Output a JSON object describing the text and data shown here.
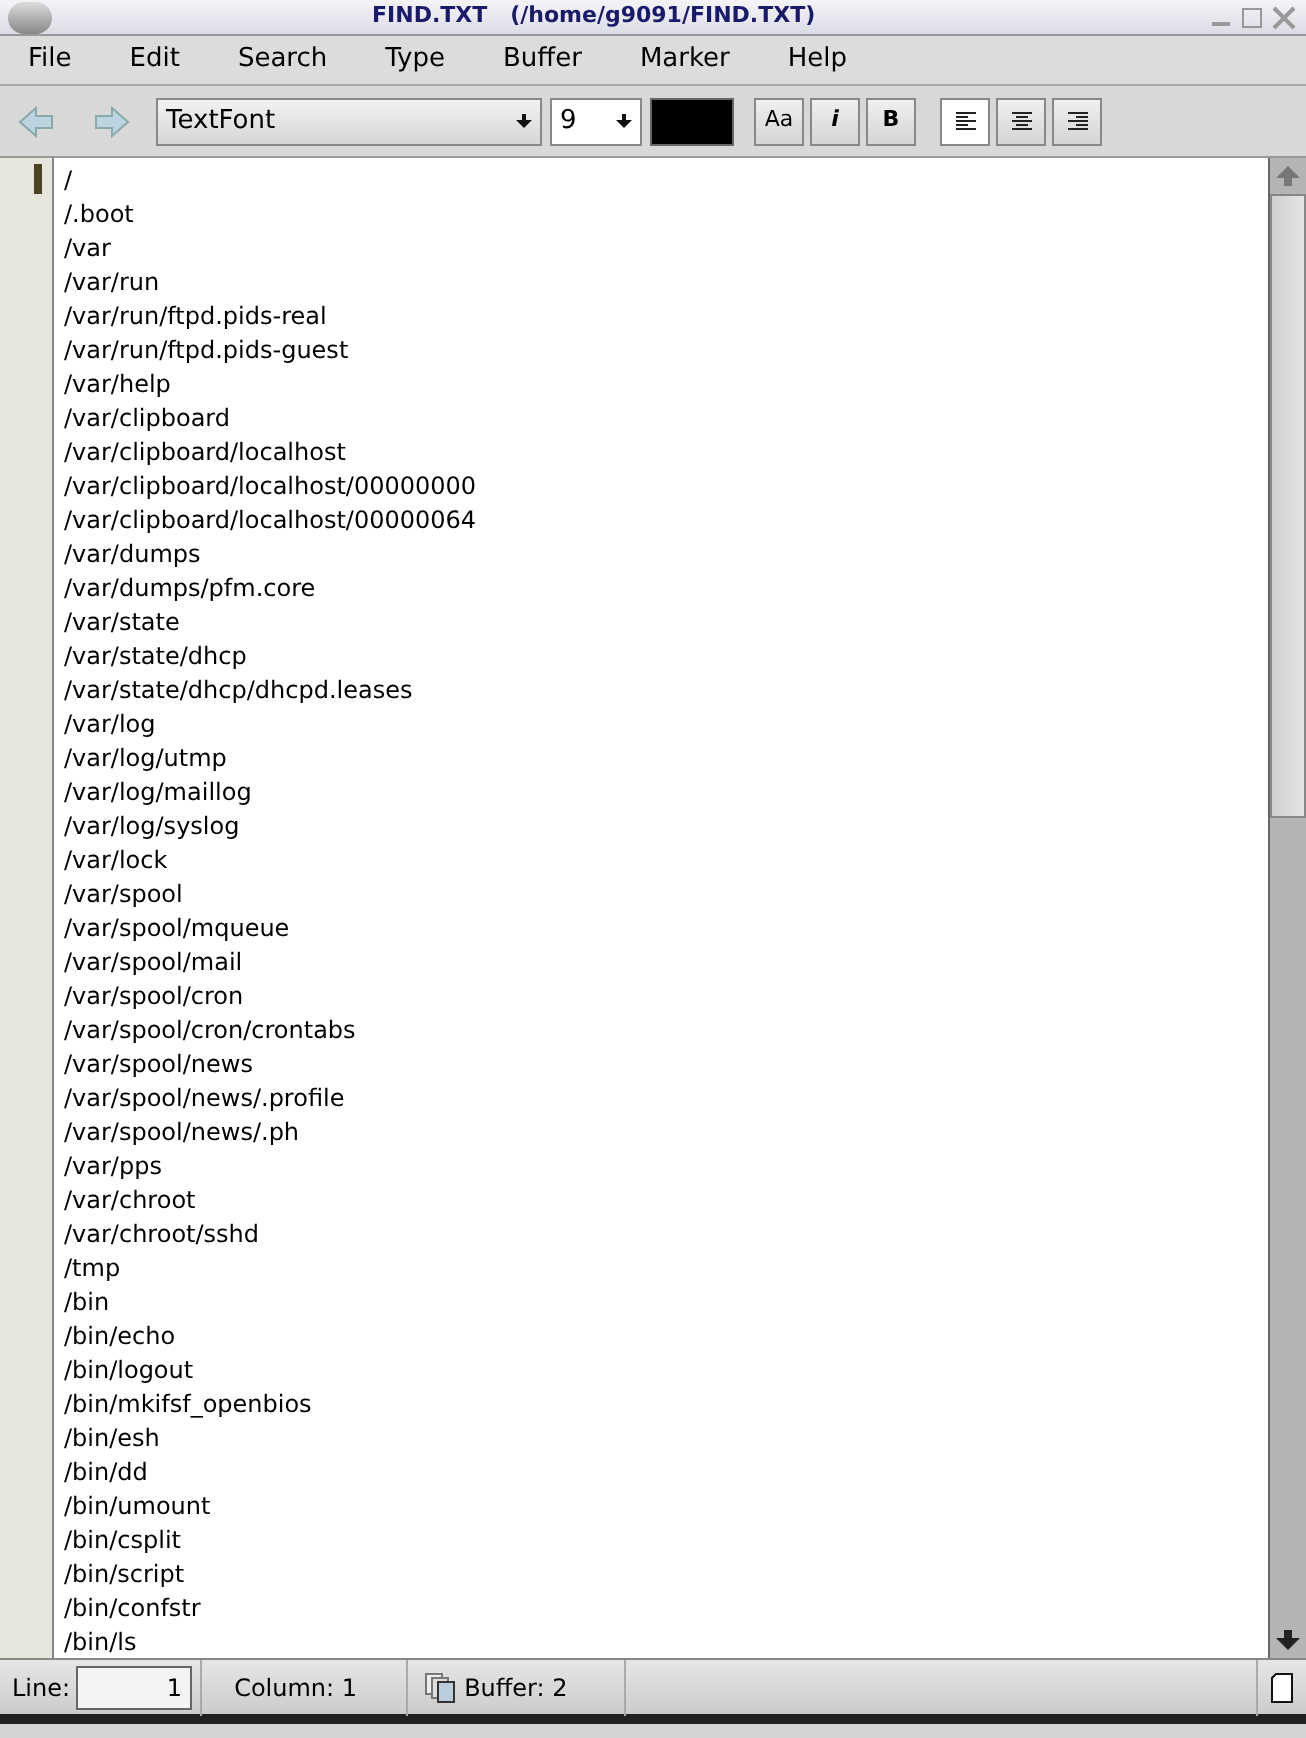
{
  "window": {
    "title": "FIND.TXT   (/home/g9091/FIND.TXT)"
  },
  "menu": [
    "File",
    "Edit",
    "Search",
    "Type",
    "Buffer",
    "Marker",
    "Help"
  ],
  "toolbar": {
    "font": "TextFont",
    "size": "9",
    "styles": [
      {
        "label": "Aa",
        "kind": "plain"
      },
      {
        "label": "i",
        "kind": "italic"
      },
      {
        "label": "B",
        "kind": "bold"
      }
    ],
    "align": [
      {
        "kind": "left",
        "selected": true
      },
      {
        "kind": "center",
        "selected": false
      },
      {
        "kind": "right",
        "selected": false
      }
    ]
  },
  "lines": [
    "/",
    "/.boot",
    "/var",
    "/var/run",
    "/var/run/ftpd.pids-real",
    "/var/run/ftpd.pids-guest",
    "/var/help",
    "/var/clipboard",
    "/var/clipboard/localhost",
    "/var/clipboard/localhost/00000000",
    "/var/clipboard/localhost/00000064",
    "/var/dumps",
    "/var/dumps/pfm.core",
    "/var/state",
    "/var/state/dhcp",
    "/var/state/dhcp/dhcpd.leases",
    "/var/log",
    "/var/log/utmp",
    "/var/log/maillog",
    "/var/log/syslog",
    "/var/lock",
    "/var/spool",
    "/var/spool/mqueue",
    "/var/spool/mail",
    "/var/spool/cron",
    "/var/spool/cron/crontabs",
    "/var/spool/news",
    "/var/spool/news/.profile",
    "/var/spool/news/.ph",
    "/var/pps",
    "/var/chroot",
    "/var/chroot/sshd",
    "/tmp",
    "/bin",
    "/bin/echo",
    "/bin/logout",
    "/bin/mkifsf_openbios",
    "/bin/esh",
    "/bin/dd",
    "/bin/umount",
    "/bin/csplit",
    "/bin/script",
    "/bin/confstr",
    "/bin/ls"
  ],
  "status": {
    "line_label": "Line:",
    "line_value": "1",
    "column": "Column: 1",
    "buffer": "Buffer: 2"
  }
}
